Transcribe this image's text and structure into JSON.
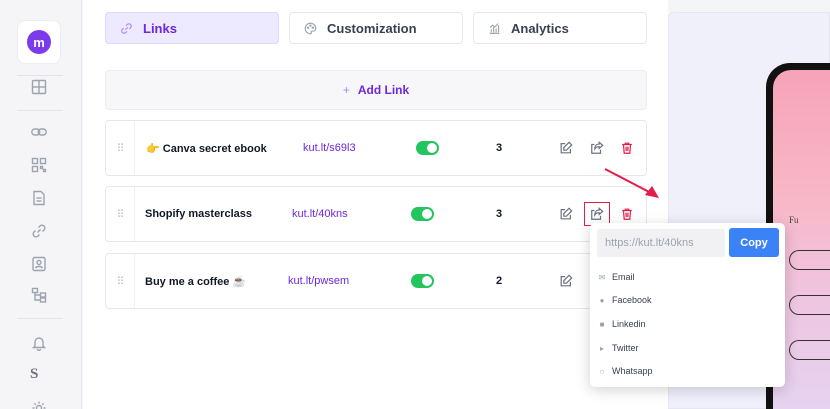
{
  "user": {
    "avatar_letter": "m"
  },
  "sidebar": {
    "icons": [
      "dashboard-icon",
      "infinity-link-icon",
      "qr-code-icon",
      "document-icon",
      "link-icon",
      "contact-card-icon",
      "hierarchy-icon",
      "bell-icon",
      "s-letter-icon",
      "settings-icon"
    ],
    "s_label": "S"
  },
  "tabs": [
    {
      "label": "Links",
      "icon": "link-icon",
      "active": true
    },
    {
      "label": "Customization",
      "icon": "palette-icon",
      "active": false
    },
    {
      "label": "Analytics",
      "icon": "analytics-icon",
      "active": false
    }
  ],
  "add_link": {
    "plus": "+",
    "label": "Add Link"
  },
  "links": [
    {
      "title": "👉 Canva secret ebook",
      "url": "kut.lt/s69l3",
      "enabled": true,
      "clicks": "3"
    },
    {
      "title": "Shopify masterclass",
      "url": "kut.lt/40kns",
      "enabled": true,
      "clicks": "3"
    },
    {
      "title": "Buy me a coffee ☕",
      "url": "kut.lt/pwsem",
      "enabled": true,
      "clicks": "2"
    }
  ],
  "share_popup": {
    "url": "https://kut.lt/40kns",
    "copy_label": "Copy",
    "options": [
      {
        "label": "Email",
        "icon": "email-icon"
      },
      {
        "label": "Facebook",
        "icon": "facebook-icon"
      },
      {
        "label": "Linkedin",
        "icon": "linkedin-icon"
      },
      {
        "label": "Twitter",
        "icon": "twitter-icon"
      },
      {
        "label": "Whatsapp",
        "icon": "whatsapp-icon"
      }
    ]
  },
  "preview": {
    "text_fragment": "Fu"
  },
  "colors": {
    "accent": "#6d28d9",
    "toggle_on": "#22c55e",
    "delete": "#e11d48",
    "copy_button": "#3b82f6",
    "annotation_red": "#e11d48"
  }
}
